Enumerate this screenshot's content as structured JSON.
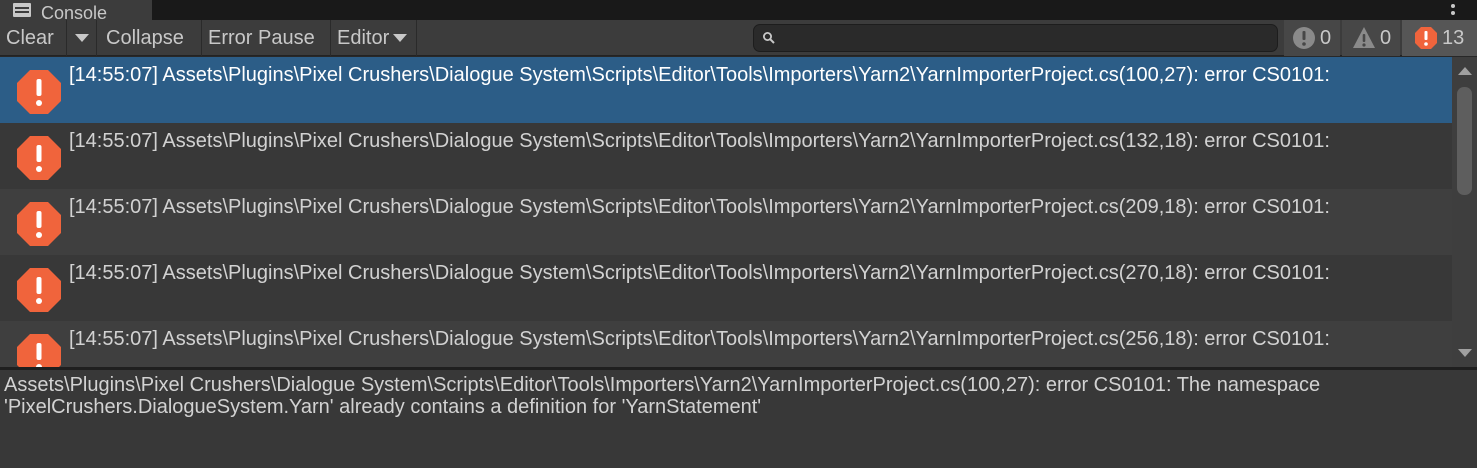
{
  "tab": {
    "title": "Console",
    "icon": "console-icon"
  },
  "toolbar": {
    "clear_label": "Clear",
    "collapse_label": "Collapse",
    "error_pause_label": "Error Pause",
    "editor_label": "Editor",
    "search": {
      "value": "",
      "placeholder": ""
    }
  },
  "counters": {
    "info": "0",
    "warnings": "0",
    "errors": "13"
  },
  "colors": {
    "error": "#f0643c",
    "selection": "#2c5d87"
  },
  "log_entries": [
    {
      "text": "[14:55:07] Assets\\Plugins\\Pixel Crushers\\Dialogue System\\Scripts\\Editor\\Tools\\Importers\\Yarn2\\YarnImporterProject.cs(100,27): error CS0101:",
      "selected": true
    },
    {
      "text": "[14:55:07] Assets\\Plugins\\Pixel Crushers\\Dialogue System\\Scripts\\Editor\\Tools\\Importers\\Yarn2\\YarnImporterProject.cs(132,18): error CS0101:",
      "selected": false
    },
    {
      "text": "[14:55:07] Assets\\Plugins\\Pixel Crushers\\Dialogue System\\Scripts\\Editor\\Tools\\Importers\\Yarn2\\YarnImporterProject.cs(209,18): error CS0101:",
      "selected": false
    },
    {
      "text": "[14:55:07] Assets\\Plugins\\Pixel Crushers\\Dialogue System\\Scripts\\Editor\\Tools\\Importers\\Yarn2\\YarnImporterProject.cs(270,18): error CS0101:",
      "selected": false
    },
    {
      "text": "[14:55:07] Assets\\Plugins\\Pixel Crushers\\Dialogue System\\Scripts\\Editor\\Tools\\Importers\\Yarn2\\YarnImporterProject.cs(256,18): error CS0101:",
      "selected": false
    }
  ],
  "detail": {
    "line1": "Assets\\Plugins\\Pixel Crushers\\Dialogue System\\Scripts\\Editor\\Tools\\Importers\\Yarn2\\YarnImporterProject.cs(100,27): error CS0101: The namespace",
    "line2": "'PixelCrushers.DialogueSystem.Yarn' already contains a definition for 'YarnStatement'"
  }
}
